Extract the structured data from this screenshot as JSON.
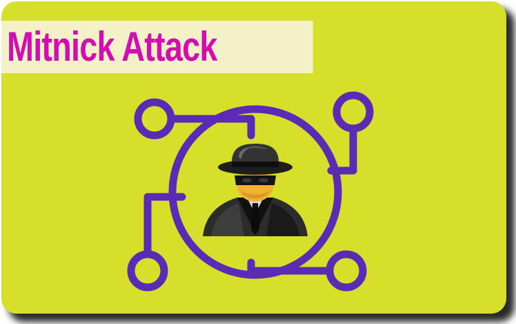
{
  "title": "Mitnick Attack",
  "colors": {
    "card_background": "#d6e02a",
    "title_band": "#f4f1c9",
    "title_text": "#d10fb0",
    "circuit": "#5b2bb5"
  },
  "icons": [
    "circuit-network-icon",
    "hacker-spy-icon"
  ]
}
